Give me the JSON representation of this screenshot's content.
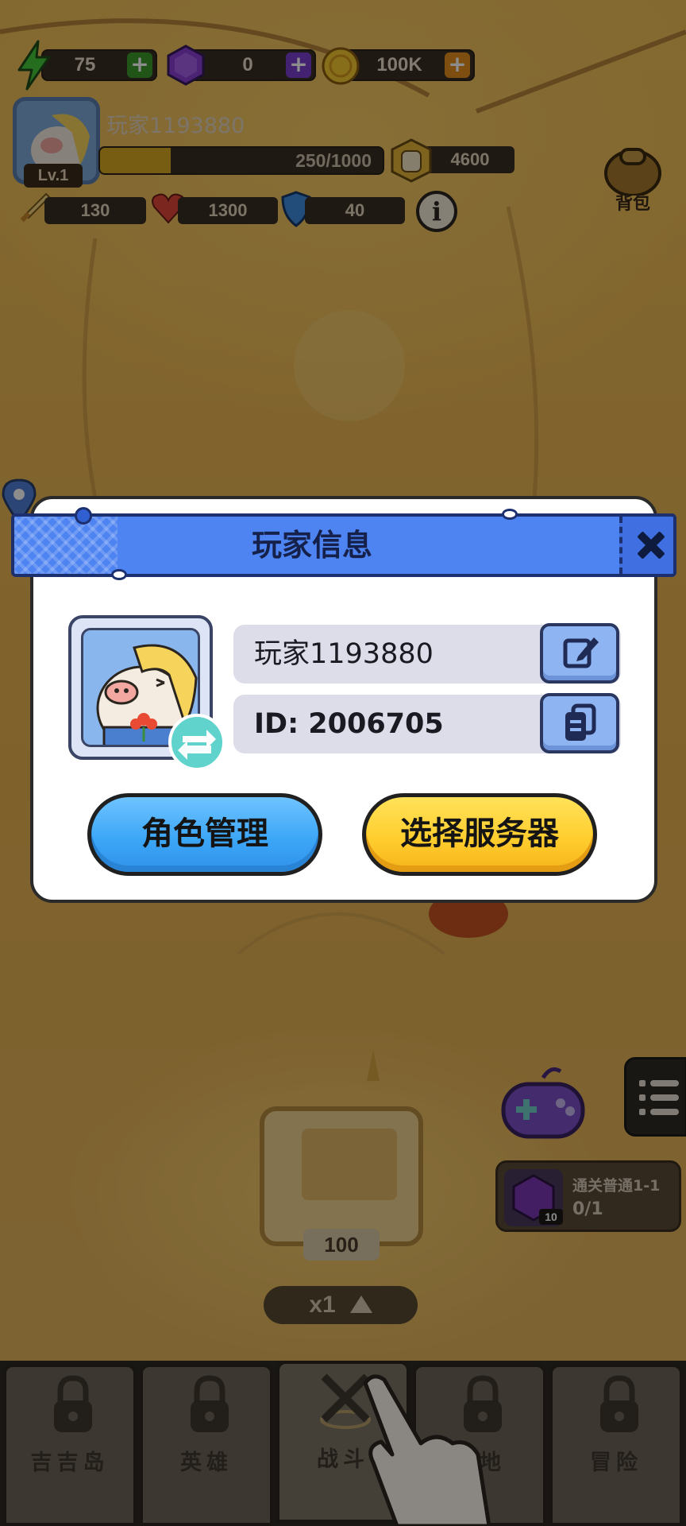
{
  "resources": {
    "energy": {
      "value": "75",
      "icon": "lightning-icon"
    },
    "gems": {
      "value": "0",
      "icon": "purple-gem-icon"
    },
    "coins": {
      "value": "100K",
      "icon": "gold-coin-icon"
    }
  },
  "player": {
    "name": "玩家1193880",
    "level": "Lv.1",
    "xp": "250/1000",
    "xp_fraction": 0.25,
    "power": "4600"
  },
  "stats": {
    "attack": "130",
    "hp": "1300",
    "defense": "40"
  },
  "bag_label": "背包",
  "quest": {
    "title": "通关普通1-1",
    "progress": "0/1",
    "reward_count": "10"
  },
  "chest_count": "100",
  "speed": "x1",
  "nav": [
    {
      "label": "吉吉岛",
      "locked": true
    },
    {
      "label": "英雄",
      "locked": true
    },
    {
      "label": "战斗",
      "locked": false
    },
    {
      "label": "基地",
      "locked": true
    },
    {
      "label": "冒险",
      "locked": true
    }
  ],
  "modal": {
    "title": "玩家信息",
    "name_field": "玩家1193880",
    "id_field": "ID: 2006705",
    "role_button": "角色管理",
    "server_button": "选择服务器"
  },
  "colors": {
    "header_blue": "#4e84f2",
    "role_button": "#3da7f7",
    "server_button": "#ffce2e",
    "xp_fill": "#d9a91f"
  }
}
